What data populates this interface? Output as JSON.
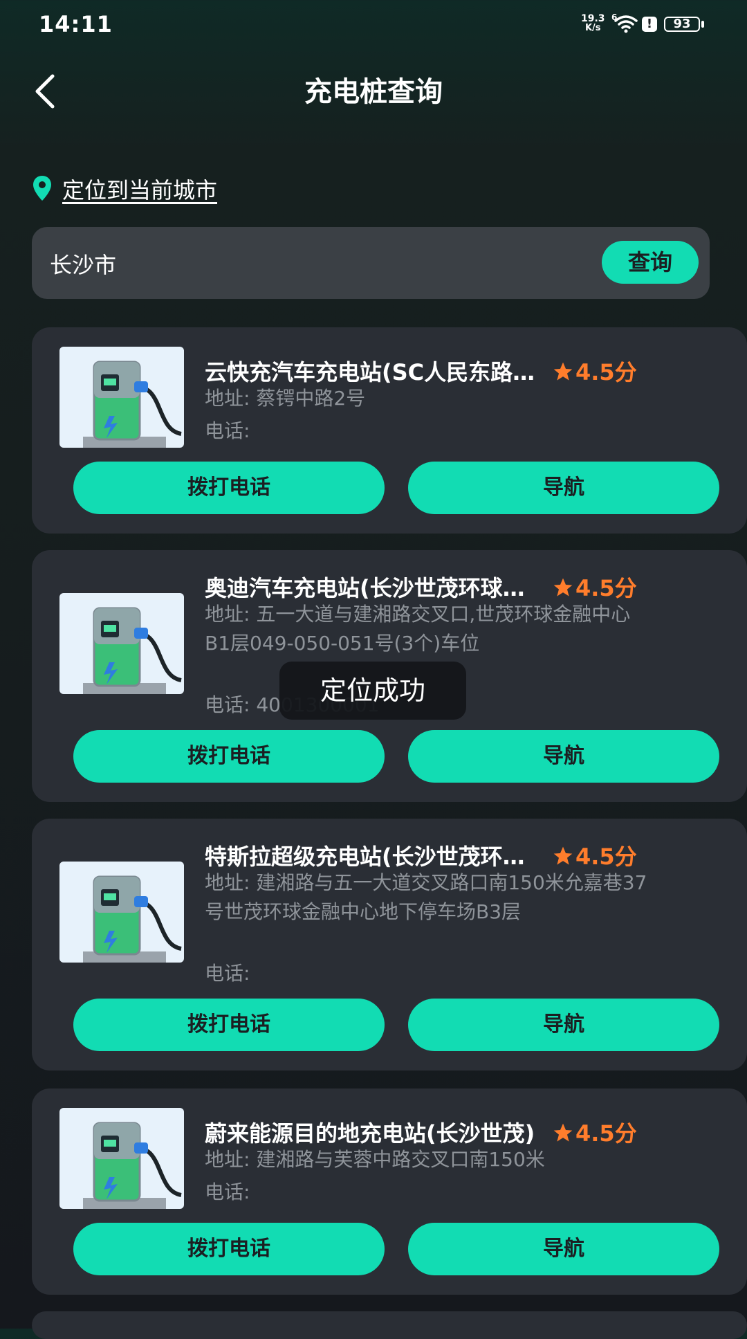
{
  "status_bar": {
    "time": "14:11",
    "net_speed": "19.3",
    "net_unit": "K/s",
    "net_sup": "6",
    "battery": "93"
  },
  "header": {
    "title": "充电桩查询"
  },
  "location": {
    "link_label": "定位到当前城市"
  },
  "search": {
    "value": "长沙市",
    "button_label": "查询"
  },
  "stations": [
    {
      "name": "云快充汽车充电站(SC人民东路站)",
      "rating": "4.5分",
      "address": "地址:  蔡锷中路2号",
      "phone": "电话:",
      "call_label": "拨打电话",
      "nav_label": "导航"
    },
    {
      "name": "奥迪汽车充电站(长沙世茂环球金融中心)",
      "rating": "4.5分",
      "address": "地址:  五一大道与建湘路交叉口,世茂环球金融中心B1层049-050-051号(3个)车位",
      "phone": "电话:  4001300001",
      "call_label": "拨打电话",
      "nav_label": "导航"
    },
    {
      "name": "特斯拉超级充电站(长沙世茂环球金融中心)",
      "rating": "4.5分",
      "address": "地址:  建湘路与五一大道交叉路口南150米允嘉巷37号世茂环球金融中心地下停车场B3层",
      "phone": "电话:",
      "call_label": "拨打电话",
      "nav_label": "导航"
    },
    {
      "name": "蔚来能源目的地充电站(长沙世茂)",
      "rating": "4.5分",
      "address": "地址:  建湘路与芙蓉中路交叉口南150米",
      "phone": "电话:",
      "call_label": "拨打电话",
      "nav_label": "导航"
    }
  ],
  "toast": {
    "message": "定位成功"
  },
  "colors": {
    "accent": "#12dcb3",
    "rating": "#ff7d2c",
    "card_bg": "#2a2e35",
    "secondary_text": "#8f949a"
  }
}
